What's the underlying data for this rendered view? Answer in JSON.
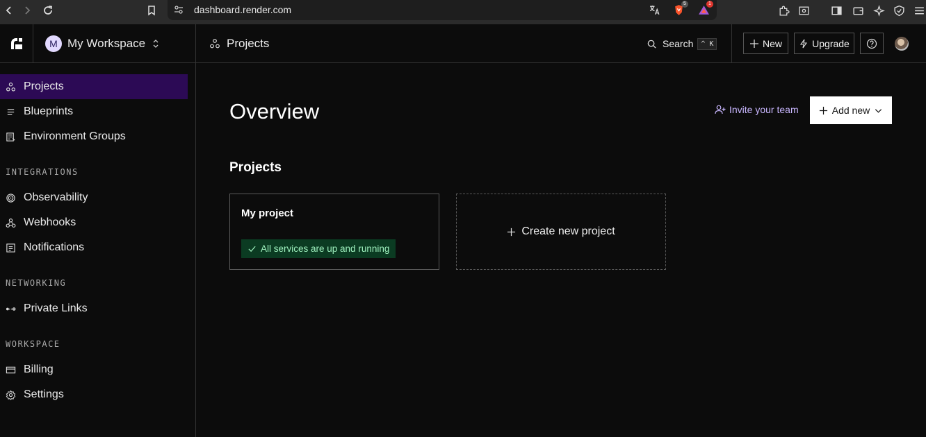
{
  "browser": {
    "url": "dashboard.render.com",
    "brave_badge": "5",
    "rewards_badge": "1"
  },
  "workspace": {
    "initial": "M",
    "name": "My Workspace"
  },
  "header": {
    "title": "Projects",
    "search_label": "Search",
    "search_shortcut": "^ K",
    "new_label": "New",
    "upgrade_label": "Upgrade"
  },
  "sidebar": {
    "items_top": [
      {
        "label": "Projects",
        "icon": "projects-icon",
        "active": true
      },
      {
        "label": "Blueprints",
        "icon": "blueprints-icon"
      },
      {
        "label": "Environment Groups",
        "icon": "environment-groups-icon"
      }
    ],
    "integrations_heading": "INTEGRATIONS",
    "integrations": [
      {
        "label": "Observability",
        "icon": "observability-icon"
      },
      {
        "label": "Webhooks",
        "icon": "webhooks-icon"
      },
      {
        "label": "Notifications",
        "icon": "notifications-icon"
      }
    ],
    "networking_heading": "NETWORKING",
    "networking": [
      {
        "label": "Private Links",
        "icon": "private-links-icon"
      }
    ],
    "workspace_heading": "WORKSPACE",
    "workspace": [
      {
        "label": "Billing",
        "icon": "billing-icon"
      },
      {
        "label": "Settings",
        "icon": "settings-icon"
      }
    ]
  },
  "main": {
    "title": "Overview",
    "invite_label": "Invite your team",
    "add_new_label": "Add new",
    "projects_heading": "Projects",
    "project_card": {
      "name": "My project",
      "status": "All services are up and running"
    },
    "create_label": "Create new project"
  },
  "colors": {
    "accent_active": "#2c0a55",
    "status_bg": "#0b3b22",
    "status_text": "#9ff2bf",
    "invite_text": "#c9b7ff"
  }
}
